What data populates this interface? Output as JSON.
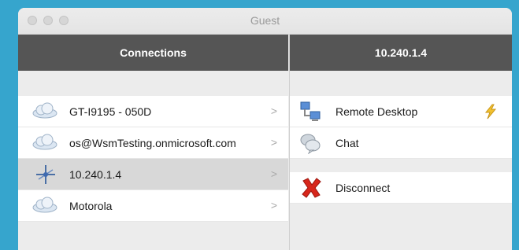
{
  "window": {
    "title": "Guest"
  },
  "left_pane": {
    "header": "Connections",
    "connections": [
      {
        "label": "GT-I9195 - 050D",
        "icon": "cloud-icon",
        "selected": false
      },
      {
        "label": "os@WsmTesting.onmicrosoft.com",
        "icon": "cloud-icon",
        "selected": false
      },
      {
        "label": "10.240.1.4",
        "icon": "network-node-icon",
        "selected": true
      },
      {
        "label": "Motorola",
        "icon": "cloud-icon",
        "selected": false
      }
    ]
  },
  "right_pane": {
    "header": "10.240.1.4",
    "actions": [
      {
        "label": "Remote Desktop",
        "icon": "remote-desktop-icon",
        "badge_icon": "lightning-icon"
      },
      {
        "label": "Chat",
        "icon": "chat-bubbles-icon"
      },
      {
        "label": "Disconnect",
        "icon": "red-x-icon"
      }
    ]
  },
  "colors": {
    "background": "#36a5cd",
    "header": "#555555",
    "selected_row": "#d8d8d8",
    "disconnect_red": "#d7261b"
  }
}
